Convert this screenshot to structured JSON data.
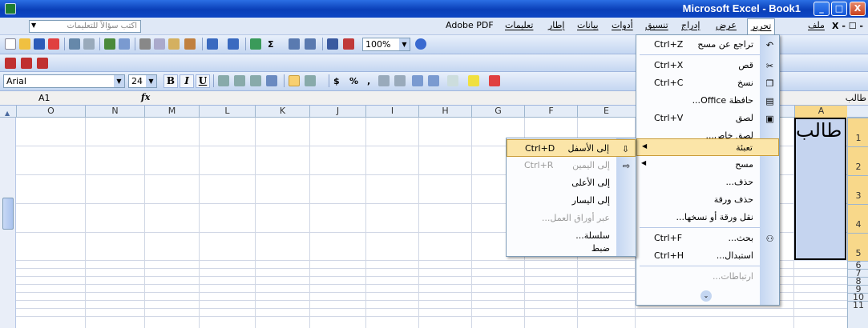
{
  "window": {
    "title": "Microsoft Excel - Book1",
    "controls": {
      "min": "_",
      "max": "□",
      "close": "X"
    }
  },
  "menubar": {
    "items": [
      "ملف",
      "تحرير",
      "عرض",
      "إدراج",
      "تنسيق",
      "أدوات",
      "بيانات",
      "إطار",
      "تعليمات",
      "Adobe PDF"
    ],
    "help_placeholder": "اكتب سؤالاً للتعليمات",
    "doc_controls": "X - ☐ -"
  },
  "standard_toolbar": {
    "zoom": "100%"
  },
  "format_toolbar": {
    "font": "Arial",
    "size": "24",
    "bold": "B",
    "italic": "I",
    "underline": "U",
    "currency": "$",
    "percent": "%",
    "comma": ","
  },
  "formula_bar": {
    "name_box": "A1",
    "fx": "fx",
    "content": "طالب"
  },
  "grid": {
    "columns": [
      "O",
      "N",
      "M",
      "L",
      "K",
      "J",
      "I",
      "H",
      "G",
      "F",
      "E",
      "A"
    ],
    "rows": [
      "1",
      "2",
      "3",
      "4",
      "5",
      "6",
      "7",
      "8",
      "9",
      "10",
      "11"
    ],
    "cell_a1": "طالب"
  },
  "edit_menu": {
    "items": [
      {
        "label": "تراجع عن مسح",
        "shortcut": "Ctrl+Z",
        "icon": "undo-icon"
      },
      {
        "label": "قص",
        "shortcut": "Ctrl+X",
        "icon": "cut-icon"
      },
      {
        "label": "نسخ",
        "shortcut": "Ctrl+C",
        "icon": "copy-icon"
      },
      {
        "label": "حافظة Office...",
        "shortcut": "",
        "icon": "clipboard-icon"
      },
      {
        "label": "لصق",
        "shortcut": "Ctrl+V",
        "icon": "paste-icon"
      },
      {
        "label": "لصق خاص...",
        "shortcut": ""
      },
      {
        "label": "تعبئة",
        "shortcut": ""
      },
      {
        "label": "مسح",
        "shortcut": ""
      },
      {
        "label": "حذف...",
        "shortcut": ""
      },
      {
        "label": "حذف ورقة",
        "shortcut": ""
      },
      {
        "label": "نقل ورقة أو نسخها...",
        "shortcut": ""
      },
      {
        "label": "بحث...",
        "shortcut": "Ctrl+F",
        "icon": "binoculars-icon"
      },
      {
        "label": "استبدال...",
        "shortcut": "Ctrl+H"
      },
      {
        "label": "ارتباطات...",
        "shortcut": ""
      }
    ]
  },
  "fill_menu": {
    "items": [
      {
        "label": "إلى الأسفل",
        "shortcut": "Ctrl+D"
      },
      {
        "label": "إلى اليمين",
        "shortcut": "Ctrl+R"
      },
      {
        "label": "إلى الأعلى",
        "shortcut": ""
      },
      {
        "label": "إلى اليسار",
        "shortcut": ""
      },
      {
        "label": "عبر أوراق العمل...",
        "shortcut": ""
      },
      {
        "label": "سلسلة...",
        "shortcut": ""
      },
      {
        "label": "ضبط",
        "shortcut": ""
      }
    ]
  }
}
